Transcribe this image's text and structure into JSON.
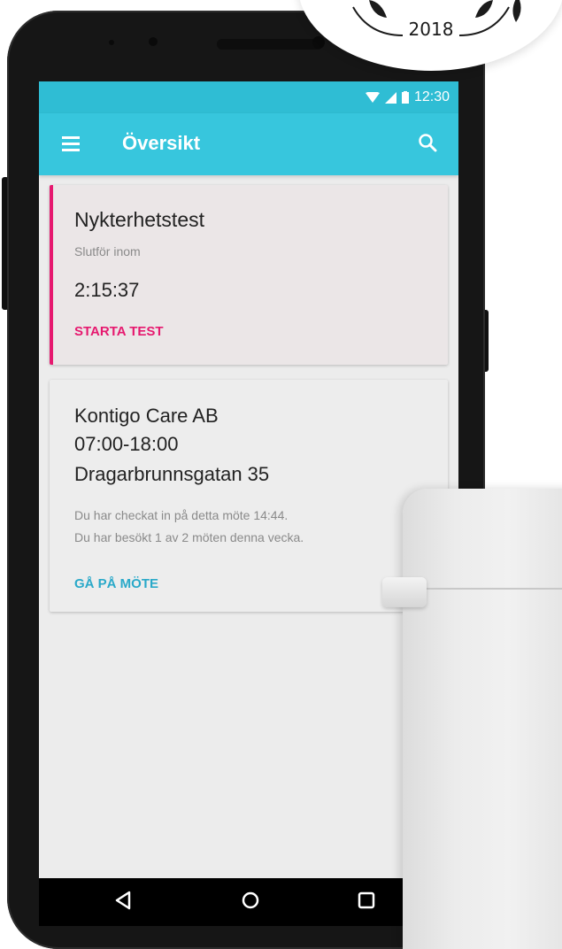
{
  "badge": {
    "year": "2018"
  },
  "status_bar": {
    "time": "12:30",
    "icons": [
      "wifi-icon",
      "signal-icon",
      "battery-icon"
    ]
  },
  "app_bar": {
    "title": "Översikt",
    "menu_icon": "menu-icon",
    "search_icon": "search-icon"
  },
  "cards": {
    "test": {
      "title": "Nykterhetstest",
      "subtitle": "Slutför inom",
      "timer": "2:15:37",
      "action": "STARTA TEST"
    },
    "meeting": {
      "name": "Kontigo Care AB",
      "hours": "07:00-18:00",
      "address": "Dragarbrunnsgatan 35",
      "note_1": "Du har checkat in på detta möte 14:44.",
      "note_2": "Du har besökt 1 av 2 möten denna vecka.",
      "action": "GÅ PÅ MÖTE"
    }
  },
  "nav_bar": {
    "buttons": [
      "back-icon",
      "home-icon",
      "recents-icon"
    ]
  },
  "colors": {
    "primary": "#37c6dd",
    "status_bar": "#2fbdd4",
    "accent_pink": "#e6196f",
    "accent_blue": "#2aa9c9"
  }
}
